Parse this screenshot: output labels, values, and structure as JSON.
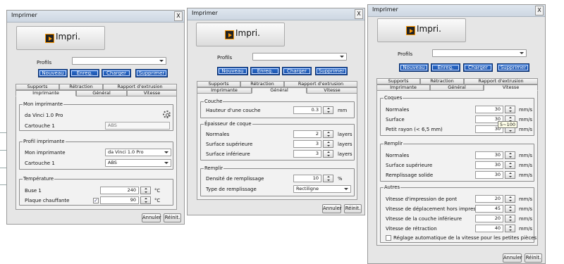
{
  "common": {
    "title": "Imprimer",
    "close": "X",
    "print_label": "Impri.",
    "profiles_label": "Profils",
    "buttons": {
      "new": "Nouveau",
      "save": "Enreg.",
      "load": "Charger",
      "delete": "Supprimer"
    },
    "tabs": {
      "supports": "Supports",
      "retraction": "Rétraction",
      "extrusion": "Rapport d'extrusion",
      "printer": "Imprimante",
      "general": "Général",
      "speed": "Vitesse"
    },
    "cancel": "Annuler",
    "reset": "Réinit."
  },
  "w1": {
    "my_printer": {
      "title": "Mon imprimante",
      "name": "da Vinci 1.0 Pro",
      "cart_label": "Cartouche 1",
      "cart_value": "ABS"
    },
    "profile": {
      "title": "Profil imprimante",
      "printer_label": "Mon imprimante",
      "printer_value": "da Vinci 1.0 Pro",
      "cart_label": "Cartouche 1",
      "cart_value": "ABS"
    },
    "temp": {
      "title": "Température",
      "nozzle_label": "Buse 1",
      "nozzle_value": "240",
      "bed_label": "Plaque chauffante",
      "bed_value": "90",
      "unit": "°C",
      "check": "✓"
    }
  },
  "w2": {
    "layer": {
      "title": "Couche",
      "height_label": "Hauteur d'une couche",
      "height_value": "0.3",
      "unit": "mm"
    },
    "shell": {
      "title": "Épaisseur de coque",
      "normal_label": "Normales",
      "normal_value": "2",
      "top_label": "Surface supérieure",
      "top_value": "3",
      "bottom_label": "Surface inférieure",
      "bottom_value": "3",
      "unit": "layers"
    },
    "fill": {
      "title": "Remplir",
      "density_label": "Densité de remplissage",
      "density_value": "10",
      "unit": "%",
      "type_label": "Type de remplissage",
      "type_value": "Rectiligne"
    }
  },
  "w3": {
    "shells": {
      "title": "Coques",
      "normal_label": "Normales",
      "normal_value": "30",
      "surface_label": "Surface",
      "surface_value": "30",
      "small_label": "Petit rayon (< 6,5 mm)",
      "small_value": "30",
      "tooltip": "5~100",
      "unit": "mm/s"
    },
    "fill": {
      "title": "Remplir",
      "normal_label": "Normales",
      "normal_value": "30",
      "top_label": "Surface supérieure",
      "top_value": "30",
      "solid_label": "Remplissage solide",
      "solid_value": "30",
      "unit": "mm/s"
    },
    "others": {
      "title": "Autres",
      "bridge_label": "Vitesse d'impression de pont",
      "bridge_value": "20",
      "travel_label": "Vitesse de déplacement hors impression",
      "travel_value": "45",
      "bottom_label": "Vitesse de la couche inférieure",
      "bottom_value": "20",
      "retract_label": "Vitesse de rétraction",
      "retract_value": "40",
      "unit": "mm/s",
      "auto_label": "Réglage automatique de la vitesse pour les petites pièces"
    }
  }
}
